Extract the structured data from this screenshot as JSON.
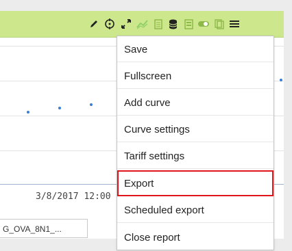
{
  "toolbar": {
    "color": "#cde88c",
    "icons": [
      "pencil-icon",
      "crosshair-icon",
      "expand-icon",
      "trend-line-icon",
      "document-icon",
      "database-icon",
      "report-icon",
      "toggle-icon",
      "bookmarks-icon",
      "hamburger-menu-icon"
    ]
  },
  "chart": {
    "x_tick_label": "3/8/2017 12:00",
    "point_color": "#3a7dd6"
  },
  "series_tab": {
    "label": "G_OVA_8N1_..."
  },
  "menu": {
    "items": [
      {
        "label": "Save"
      },
      {
        "label": "Fullscreen"
      },
      {
        "label": "Add curve"
      },
      {
        "label": "Curve settings"
      },
      {
        "label": "Tariff settings"
      },
      {
        "label": "Export",
        "highlighted": true
      },
      {
        "label": "Scheduled export"
      },
      {
        "label": "Close report"
      }
    ],
    "highlight_color": "#e0141b"
  }
}
